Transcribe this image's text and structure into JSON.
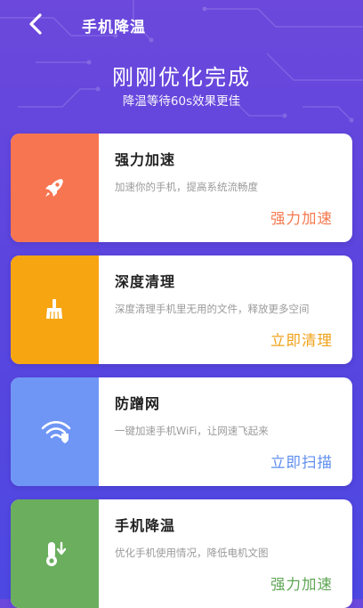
{
  "header": {
    "back_icon": "chevron-left-icon",
    "title": "手机降温"
  },
  "result": {
    "headline": "刚刚优化完成",
    "subline": "降温等待60s效果更佳"
  },
  "cards": [
    {
      "title": "强力加速",
      "desc": "加速你的手机，提高系统流畅度",
      "action": "强力加速",
      "icon": "rocket-icon",
      "color": "#f77550",
      "action_color": "#f4794e"
    },
    {
      "title": "深度清理",
      "desc": "深度清理手机里无用的文件，释放更多空间",
      "action": "立即清理",
      "icon": "broom-icon",
      "color": "#f7a511",
      "action_color": "#f0a21a"
    },
    {
      "title": "防蹭网",
      "desc": "一键加速手机WiFi，让网速飞起来",
      "action": "立即扫描",
      "icon": "wifi-shield-icon",
      "color": "#6f96f5",
      "action_color": "#5f8ef0"
    },
    {
      "title": "手机降温",
      "desc": "优化手机使用情况，降低电机文图",
      "action": "强力加速",
      "icon": "thermometer-icon",
      "color": "#6aae5e",
      "action_color": "#5fa655"
    }
  ]
}
